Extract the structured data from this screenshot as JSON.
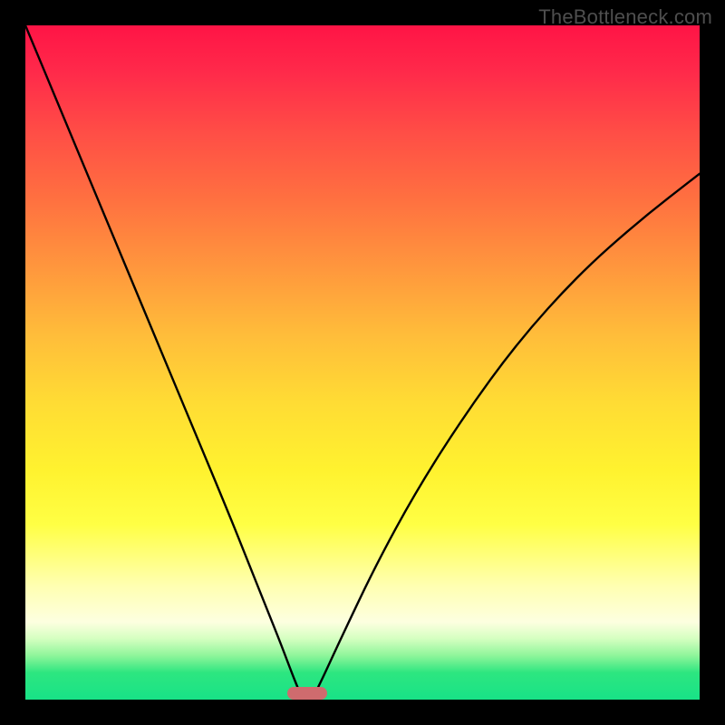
{
  "watermark": "TheBottleneck.com",
  "marker": {
    "x_fraction": 0.418
  },
  "chart_data": {
    "type": "line",
    "title": "",
    "xlabel": "",
    "ylabel": "",
    "xlim": [
      0,
      1
    ],
    "ylim": [
      0,
      1
    ],
    "series": [
      {
        "name": "left-curve",
        "x": [
          0.0,
          0.05,
          0.1,
          0.15,
          0.2,
          0.25,
          0.3,
          0.33,
          0.36,
          0.38,
          0.395,
          0.405,
          0.412
        ],
        "y": [
          1.0,
          0.88,
          0.76,
          0.64,
          0.52,
          0.4,
          0.28,
          0.205,
          0.13,
          0.08,
          0.04,
          0.015,
          0.0
        ]
      },
      {
        "name": "right-curve",
        "x": [
          0.425,
          0.44,
          0.47,
          0.52,
          0.58,
          0.65,
          0.73,
          0.82,
          0.91,
          1.0
        ],
        "y": [
          0.0,
          0.03,
          0.095,
          0.2,
          0.31,
          0.42,
          0.53,
          0.63,
          0.71,
          0.78
        ]
      }
    ],
    "gradient_note": "vertical gradient red->orange->yellow->pale->green encodes bottleneck severity (top=bad, bottom=good)"
  }
}
